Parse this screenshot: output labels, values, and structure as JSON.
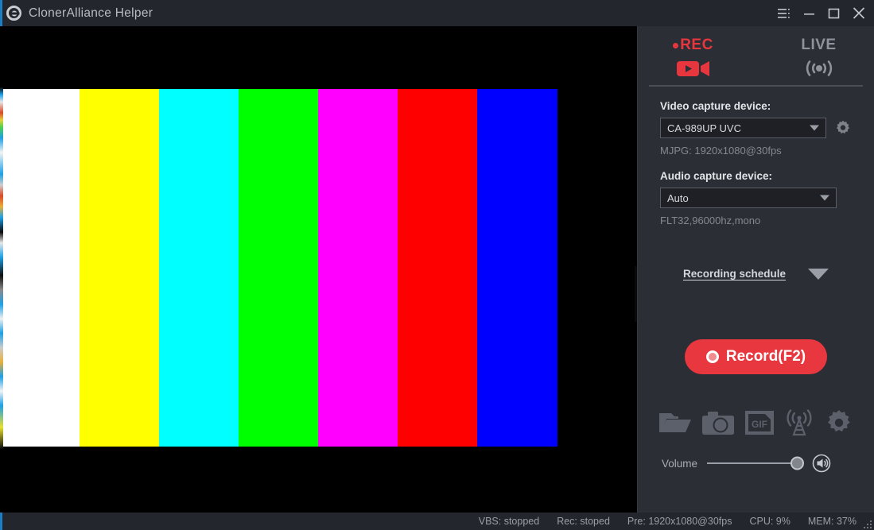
{
  "window": {
    "title": "ClonerAlliance Helper",
    "logo_icon": "lifebuoy-icon",
    "controls": [
      {
        "name": "menu-button",
        "icon": "hamburger-menu-icon"
      },
      {
        "name": "minimize-button",
        "icon": "minimize-icon"
      },
      {
        "name": "maximize-button",
        "icon": "maximize-icon"
      },
      {
        "name": "close-button",
        "icon": "close-icon"
      }
    ]
  },
  "preview": {
    "name": "video-preview",
    "color_bars": [
      "#ffffff",
      "#ffff00",
      "#00ffff",
      "#00ff00",
      "#ff00ff",
      "#ff0000",
      "#0000ff"
    ],
    "background": "#000000",
    "toggle_icon": "chevron-right-icon"
  },
  "panel": {
    "tabs": [
      {
        "label": "REC",
        "icon": "camcorder-icon",
        "active": true,
        "color": "#e8363f"
      },
      {
        "label": "LIVE",
        "icon": "broadcast-waves-icon",
        "active": false,
        "color": "#8e929a"
      }
    ],
    "video": {
      "label": "Video capture device:",
      "value": "CA-989UP UVC",
      "hint": "MJPG: 1920x1080@30fps",
      "settings_icon": "gear-icon"
    },
    "audio": {
      "label": "Audio capture device:",
      "value": "Auto",
      "hint": "FLT32,96000hz,mono"
    },
    "schedule": {
      "label": "Recording schedule",
      "icon": "chevron-down-icon"
    },
    "record": {
      "label": "Record(F2)",
      "icon": "record-dot-icon",
      "color": "#e8373f"
    },
    "toolbar": [
      {
        "name": "open-folder-button",
        "icon": "folder-icon"
      },
      {
        "name": "snapshot-button",
        "icon": "camera-icon"
      },
      {
        "name": "gif-button",
        "icon": "gif-icon"
      },
      {
        "name": "stream-button",
        "icon": "antenna-icon"
      },
      {
        "name": "settings-button",
        "icon": "gear-icon"
      }
    ],
    "volume": {
      "label": "Volume",
      "value": 100,
      "icon": "speaker-icon"
    }
  },
  "statusbar": {
    "items": [
      "VBS: stopped",
      "Rec: stoped",
      "Pre: 1920x1080@30fps",
      "CPU: 9%",
      "MEM: 37%"
    ],
    "grip_icon": "resize-grip-icon"
  }
}
